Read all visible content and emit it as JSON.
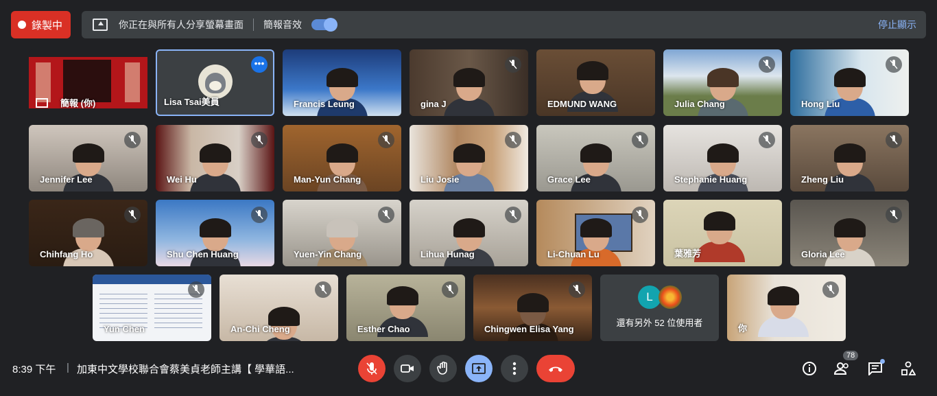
{
  "recording": {
    "label": "錄製中"
  },
  "share_bar": {
    "message": "你正在與所有人分享螢幕畫面",
    "audio_label": "簡報音效",
    "stop_label": "停止顯示"
  },
  "presentation": {
    "label": "簡報 (你)"
  },
  "participants": [
    {
      "name": "Lisa Tsai美員"
    },
    {
      "name": "Francis Leung"
    },
    {
      "name": "gina J"
    },
    {
      "name": "EDMUND WANG"
    },
    {
      "name": "Julia Chang"
    },
    {
      "name": "Hong Liu"
    },
    {
      "name": "Jennifer Lee"
    },
    {
      "name": "Wei Hu"
    },
    {
      "name": "Man-Yun Chang"
    },
    {
      "name": "Liu Josie"
    },
    {
      "name": "Grace Lee"
    },
    {
      "name": "Stephanie Huang"
    },
    {
      "name": "Zheng Liu"
    },
    {
      "name": "Chihfang Ho"
    },
    {
      "name": "Shu Chen Huang"
    },
    {
      "name": "Yuen-Yin Chang"
    },
    {
      "name": "Lihua Hunag"
    },
    {
      "name": "Li-Chuan Lu"
    },
    {
      "name": "葉雅芳"
    },
    {
      "name": "Gloria Lee"
    },
    {
      "name": "Yun Chen"
    },
    {
      "name": "An-Chi Cheng"
    },
    {
      "name": "Esther Chao"
    },
    {
      "name": "Chingwen Elisa Yang"
    },
    {
      "name": "你"
    }
  ],
  "others": {
    "avatar_letter": "L",
    "label": "還有另外 52 位使用者"
  },
  "footer": {
    "time": "8:39 下午",
    "separator": "|",
    "meeting_title": "加東中文學校聯合會蔡美貞老師主講【 學華語..."
  },
  "people_count": "78",
  "colors": {
    "accent": "#8ab4f8",
    "red": "#ea4335",
    "tile_bg": "#3c4043"
  }
}
